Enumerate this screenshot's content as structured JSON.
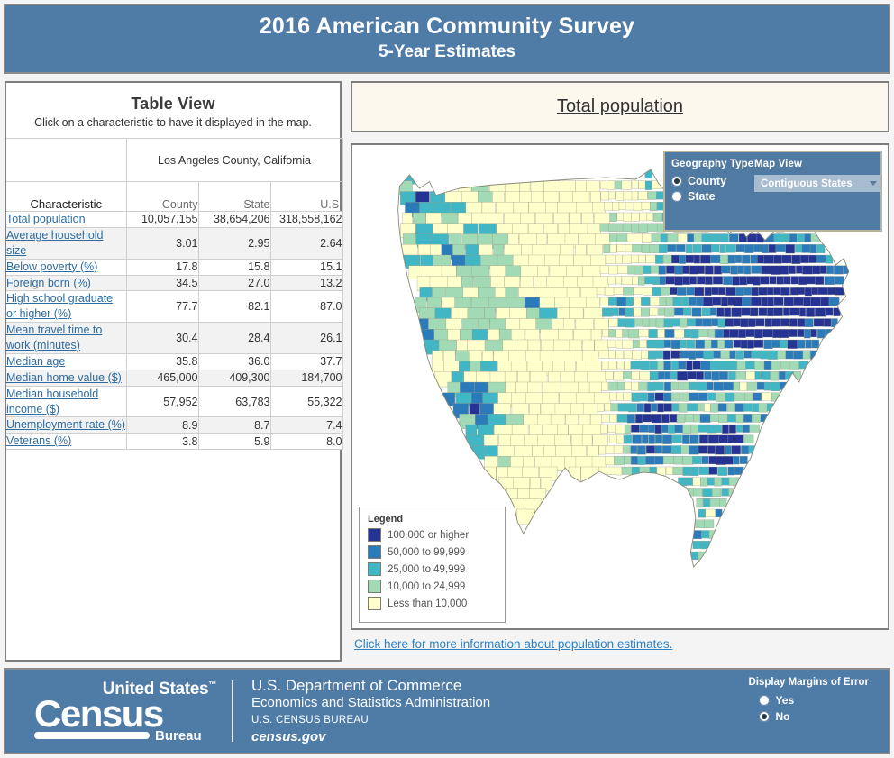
{
  "header": {
    "line1": "2016 American Community Survey",
    "line2": "5-Year Estimates"
  },
  "table_view": {
    "title": "Table View",
    "subtitle": "Click on a characteristic to have it displayed in the map.",
    "geography_label": "Los Angeles County, California",
    "characteristic_header": "Characteristic",
    "columns": [
      "County",
      "State",
      "U.S."
    ],
    "rows": [
      {
        "label": "Total population",
        "county": "10,057,155",
        "state": "38,654,206",
        "us": "318,558,162"
      },
      {
        "label": "Average household size",
        "county": "3.01",
        "state": "2.95",
        "us": "2.64"
      },
      {
        "label": "Below poverty (%)",
        "county": "17.8",
        "state": "15.8",
        "us": "15.1"
      },
      {
        "label": "Foreign born (%)",
        "county": "34.5",
        "state": "27.0",
        "us": "13.2"
      },
      {
        "label": "High school graduate or higher (%)",
        "county": "77.7",
        "state": "82.1",
        "us": "87.0"
      },
      {
        "label": "Mean travel time to work (minutes)",
        "county": "30.4",
        "state": "28.4",
        "us": "26.1"
      },
      {
        "label": "Median age",
        "county": "35.8",
        "state": "36.0",
        "us": "37.7"
      },
      {
        "label": "Median home value ($)",
        "county": "465,000",
        "state": "409,300",
        "us": "184,700"
      },
      {
        "label": "Median household income ($)",
        "county": "57,952",
        "state": "63,783",
        "us": "55,322"
      },
      {
        "label": "Unemployment rate (%)",
        "county": "8.9",
        "state": "8.7",
        "us": "7.4"
      },
      {
        "label": "Veterans (%)",
        "county": "3.8",
        "state": "5.9",
        "us": "8.0"
      }
    ]
  },
  "map": {
    "title": "Total population",
    "controls": {
      "geography_type_label": "Geography Type",
      "geography_options": [
        "County",
        "State"
      ],
      "geography_selected": "County",
      "map_view_label": "Map View",
      "map_view_selected": "Contiguous States"
    },
    "legend": {
      "title": "Legend",
      "items": [
        {
          "label": "100,000 or higher",
          "color": "#253494"
        },
        {
          "label": "50,000 to 99,999",
          "color": "#2b7bba"
        },
        {
          "label": "25,000 to 49,999",
          "color": "#41b6c4"
        },
        {
          "label": "10,000 to 24,999",
          "color": "#a1dab4"
        },
        {
          "label": "Less than 10,000",
          "color": "#ffffcc"
        }
      ]
    },
    "info_link": "Click here for more information about population estimates."
  },
  "footer": {
    "logo": {
      "united_states": "United States",
      "census": "Census",
      "bureau": "Bureau"
    },
    "department_line1": "U.S. Department of Commerce",
    "department_line2": "Economics and Statistics Administration",
    "department_line3": "U.S. CENSUS BUREAU",
    "department_line4": "census.gov",
    "moe_title": "Display Margins of Error",
    "moe_options": [
      "Yes",
      "No"
    ],
    "moe_selected": "No"
  },
  "colors": {
    "brand_blue": "#4f7ba7",
    "title_bg": "#fdf8ee",
    "link": "#2d6ca2"
  }
}
